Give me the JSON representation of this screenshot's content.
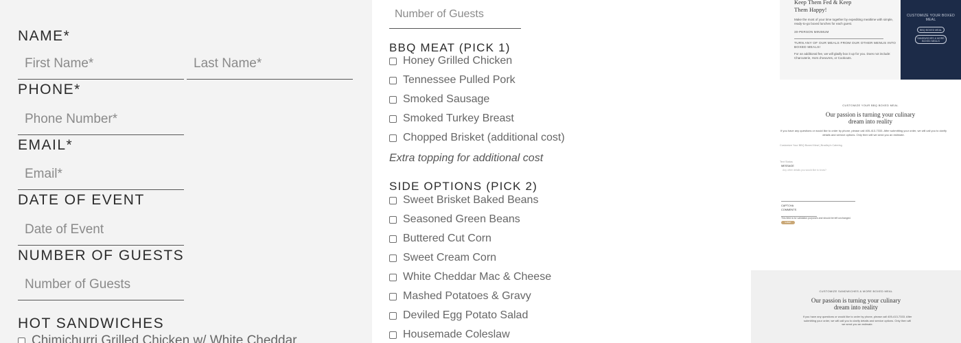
{
  "left": {
    "name_label": "NAME*",
    "first_name_placeholder": "First Name*",
    "last_name_placeholder": "Last Name*",
    "phone_label": "PHONE*",
    "phone_placeholder": "Phone Number*",
    "email_label": "EMAIL*",
    "email_placeholder": "Email*",
    "date_label": "DATE OF EVENT",
    "date_placeholder": "Date of Event",
    "guests_label": "NUMBER OF GUESTS",
    "guests_placeholder": "Number of Guests",
    "hot_sandwiches_label": "HOT SANDWICHES",
    "hot_sandwich_first_option": "Chimichurri Grilled Chicken w/ White Cheddar"
  },
  "middle": {
    "guests_placeholder": "Number of Guests",
    "bbq_label": "BBQ MEAT (PICK 1)",
    "bbq_options": [
      "Honey Grilled Chicken",
      "Tennessee Pulled Pork",
      "Smoked Sausage",
      "Smoked Turkey Breast",
      "Chopped Brisket (additional cost)"
    ],
    "extra_note": "Extra topping for additional cost",
    "sides_label": "SIDE OPTIONS (PICK 2)",
    "side_options": [
      "Sweet Brisket Baked Beans",
      "Seasoned Green Beans",
      "Buttered Cut Corn",
      "Sweet Cream Corn",
      "White Cheddar Mac & Cheese",
      "Mashed Potatoes & Gravy",
      "Deviled Egg Potato Salad",
      "Housemade Coleslaw"
    ]
  },
  "thumbs": {
    "t1_title_1": "Keep Them Fed & Keep",
    "t1_title_2": "Them Happy!",
    "t1_body": "Make the most of your time together by expediting mealtime with simple, ready-to-go boxed lunches for each guest.",
    "t1_min": "30-PERSON MINIMUM",
    "t1_turn": "TURN ANY OF OUR MEALS FROM OUR OTHER MENUS INTO BOXED MEALS!",
    "t1_addl": "For an additional fee, we will gladly box it up for you. Does not include: Charcuterie, Hors d'oeuvres, or Cookouts.",
    "t1_navy_heading": "CUSTOMIZE YOUR BOXED MEAL",
    "t1_pill_1": "BBQ BOXED MEAL",
    "t1_pill_2": "SANDWICHES & MORE BOXED MEALS",
    "t2_small": "CUSTOMIZE YOUR BBQ BOXED MEAL",
    "t2_heading_1": "Our passion is turning your culinary",
    "t2_heading_2": "dream into reality",
    "t2_body": "If you have any questions or would like to order by phone, please call 405-413-7333. After submitting your order, we will call you to clarify details and service options. Only then will we send you an estimate.",
    "t2_image_alt": "Customize Your BBQ Boxed Meal | Bradley's Catering",
    "t2_sms": "Text Status",
    "t2_message": "MESSAGE",
    "t2_message_placeholder": "Any other details you would like to know?",
    "t2_captcha": "CAPTCHA",
    "t2_comments": "COMMENTS",
    "t2_validation": "This field is for validation purposes and should be left unchanged.",
    "t2_submit": "SUBMIT",
    "t3_small": "CUSTOMIZE SANDWICHES & MORE BOXED MEAL",
    "t3_heading_1": "Our passion is turning your culinary",
    "t3_heading_2": "dream into reality",
    "t3_body": "If you have any questions or would like to order by phone, please call 405-413-7333. After submitting your order, we will call you to clarify details and service options. Only then will we send you an estimate."
  },
  "colors": {
    "navy": "#1c2b48",
    "accent_gold": "#c9a776"
  }
}
